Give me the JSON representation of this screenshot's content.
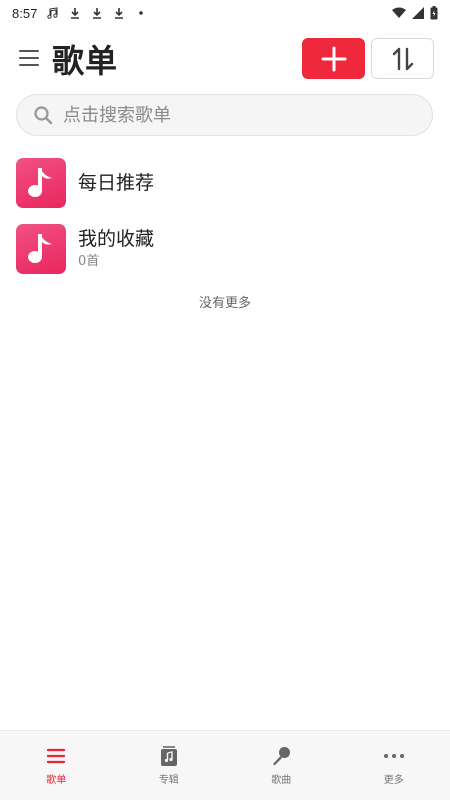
{
  "status_bar": {
    "time": "8:57",
    "icons": [
      "music-note-icon",
      "download-icon",
      "download-icon",
      "download-icon",
      "dot-icon"
    ],
    "right_icons": [
      "wifi-icon",
      "signal-icon",
      "battery-icon"
    ]
  },
  "header": {
    "title": "歌单",
    "add_icon": "plus-icon",
    "sort_icon": "sort-icon"
  },
  "search": {
    "placeholder": "点击搜索歌单",
    "value": ""
  },
  "playlists": [
    {
      "title": "每日推荐",
      "subtitle": ""
    },
    {
      "title": "我的收藏",
      "subtitle": "0首"
    }
  ],
  "list_footer": "没有更多",
  "bottom_nav": {
    "items": [
      {
        "label": "歌单",
        "icon": "list-icon",
        "active": true
      },
      {
        "label": "专辑",
        "icon": "album-icon",
        "active": false
      },
      {
        "label": "歌曲",
        "icon": "microphone-icon",
        "active": false
      },
      {
        "label": "更多",
        "icon": "more-icon",
        "active": false
      }
    ]
  },
  "colors": {
    "accent": "#f0283c",
    "cover_gradient_start": "#f25184",
    "cover_gradient_end": "#e8265c"
  }
}
